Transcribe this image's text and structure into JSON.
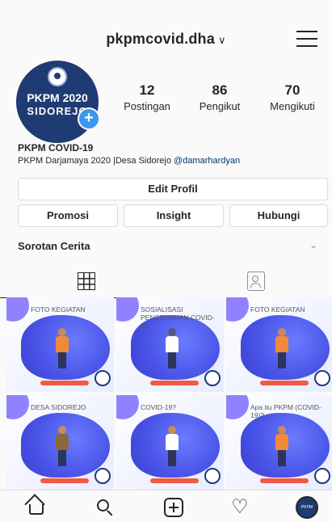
{
  "header": {
    "username": "pkpmcovid.dha",
    "chevron": "∨"
  },
  "profile": {
    "avatar_line1": "PKPM 2020",
    "avatar_line2": "SIDOREJO",
    "add_symbol": "+",
    "stats": [
      {
        "value": "12",
        "label": "Postingan"
      },
      {
        "value": "86",
        "label": "Pengikut"
      },
      {
        "value": "70",
        "label": "Mengikuti"
      }
    ],
    "name": "PKPM COVID-19",
    "bio": "PKPM Darjamaya 2020 |Desa Sidorejo ",
    "mention": "@damarhardyan"
  },
  "actions": {
    "edit_profile": "Edit Profil",
    "promote": "Promosi",
    "insight": "Insight",
    "contact": "Hubungi"
  },
  "highlights": {
    "label": "Sorotan Cerita",
    "chevron": "⌄"
  },
  "posts": [
    {
      "caption": "FOTO KEGIATAN"
    },
    {
      "caption": "SOSIALISASI PENCEGAHAN COVID-19"
    },
    {
      "caption": "FOTO KEGIATAN"
    },
    {
      "caption": "DESA SIDOREJO"
    },
    {
      "caption": "COVID-19?"
    },
    {
      "caption": "Apa itu PKPM (COVID-19)?"
    }
  ],
  "nav": {
    "heart_glyph": "♡",
    "profile_text": "PKPM"
  },
  "colors": {
    "accent": "#3897f0",
    "brand_navy": "#1f3b73",
    "post_blue": "#4a55e8",
    "post_red": "#f05a45"
  }
}
